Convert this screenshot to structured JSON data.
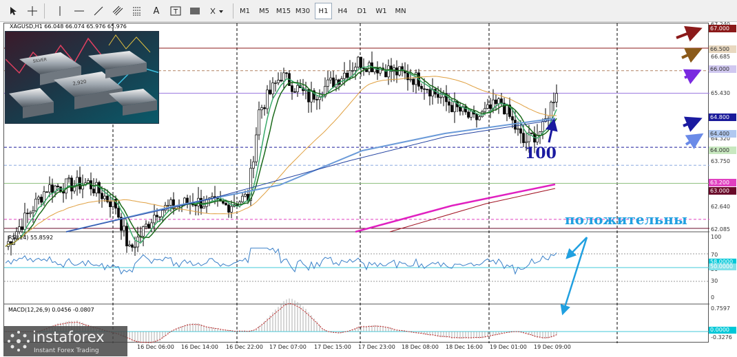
{
  "toolbar": {
    "timeframes": [
      "M1",
      "M5",
      "M15",
      "M30",
      "H1",
      "H4",
      "D1",
      "W1",
      "MN"
    ],
    "active": "H1"
  },
  "chart": {
    "symbol_info": "XAGUSD,H1  66.048 66.074 65.976 65.976"
  },
  "price_axis": {
    "labels": [
      "67.240",
      "66.685",
      "66.100",
      "65.430",
      "64.320",
      "63.750",
      "62.640",
      "62.085"
    ]
  },
  "hlines": [
    {
      "label": "67.000",
      "bg": "#8b1a1a",
      "fg": "#ffffff"
    },
    {
      "label": "66.500",
      "bg": "#e8d8c0",
      "fg": "#333333"
    },
    {
      "label": "66.000",
      "bg": "#d0c8f0",
      "fg": "#333333"
    },
    {
      "label": "64.800",
      "bg": "#1a1a9a",
      "fg": "#ffffff"
    },
    {
      "label": "64.400",
      "bg": "#b0c8f0",
      "fg": "#333333"
    },
    {
      "label": "64.000",
      "bg": "#c8e8c0",
      "fg": "#333333"
    },
    {
      "label": "63.200",
      "bg": "#e040c0",
      "fg": "#ffffff"
    },
    {
      "label": "63.000",
      "bg": "#6a0a2a",
      "fg": "#ffffff"
    }
  ],
  "annotations": {
    "ma_label": "100",
    "note": "положительны"
  },
  "rsi": {
    "title": "RSI(14) 55.8592",
    "levels": [
      "100",
      "70",
      "50",
      "30",
      "0"
    ],
    "current": "58.0000",
    "mid": "50.0000"
  },
  "macd": {
    "title": "MACD(12,26,9) 0.0456 -0.0807",
    "levels": [
      "0.7597",
      "0.0000",
      "-0.3276"
    ]
  },
  "time_axis": {
    "labels": [
      "16 Dec 06:00",
      "16 Dec 14:00",
      "16 Dec 22:00",
      "17 Dec 07:00",
      "17 Dec 15:00",
      "17 Dec 23:00",
      "18 Dec 08:00",
      "18 Dec 16:00",
      "19 Dec 01:00",
      "19 Dec 09:00"
    ]
  },
  "logo": {
    "name": "instaforex",
    "tagline": "Instant Forex Trading"
  },
  "colors": {
    "up": "#000000",
    "down": "#000000",
    "ma_fast": "#3aaa6a",
    "ma_slow": "#1a6a1a",
    "ma_orange": "#e0a040",
    "ma_blue1": "#2040a0",
    "ma_blue2": "#6a9ad8",
    "ma_magenta": "#e020c0",
    "ma_darkred": "#a01020"
  }
}
